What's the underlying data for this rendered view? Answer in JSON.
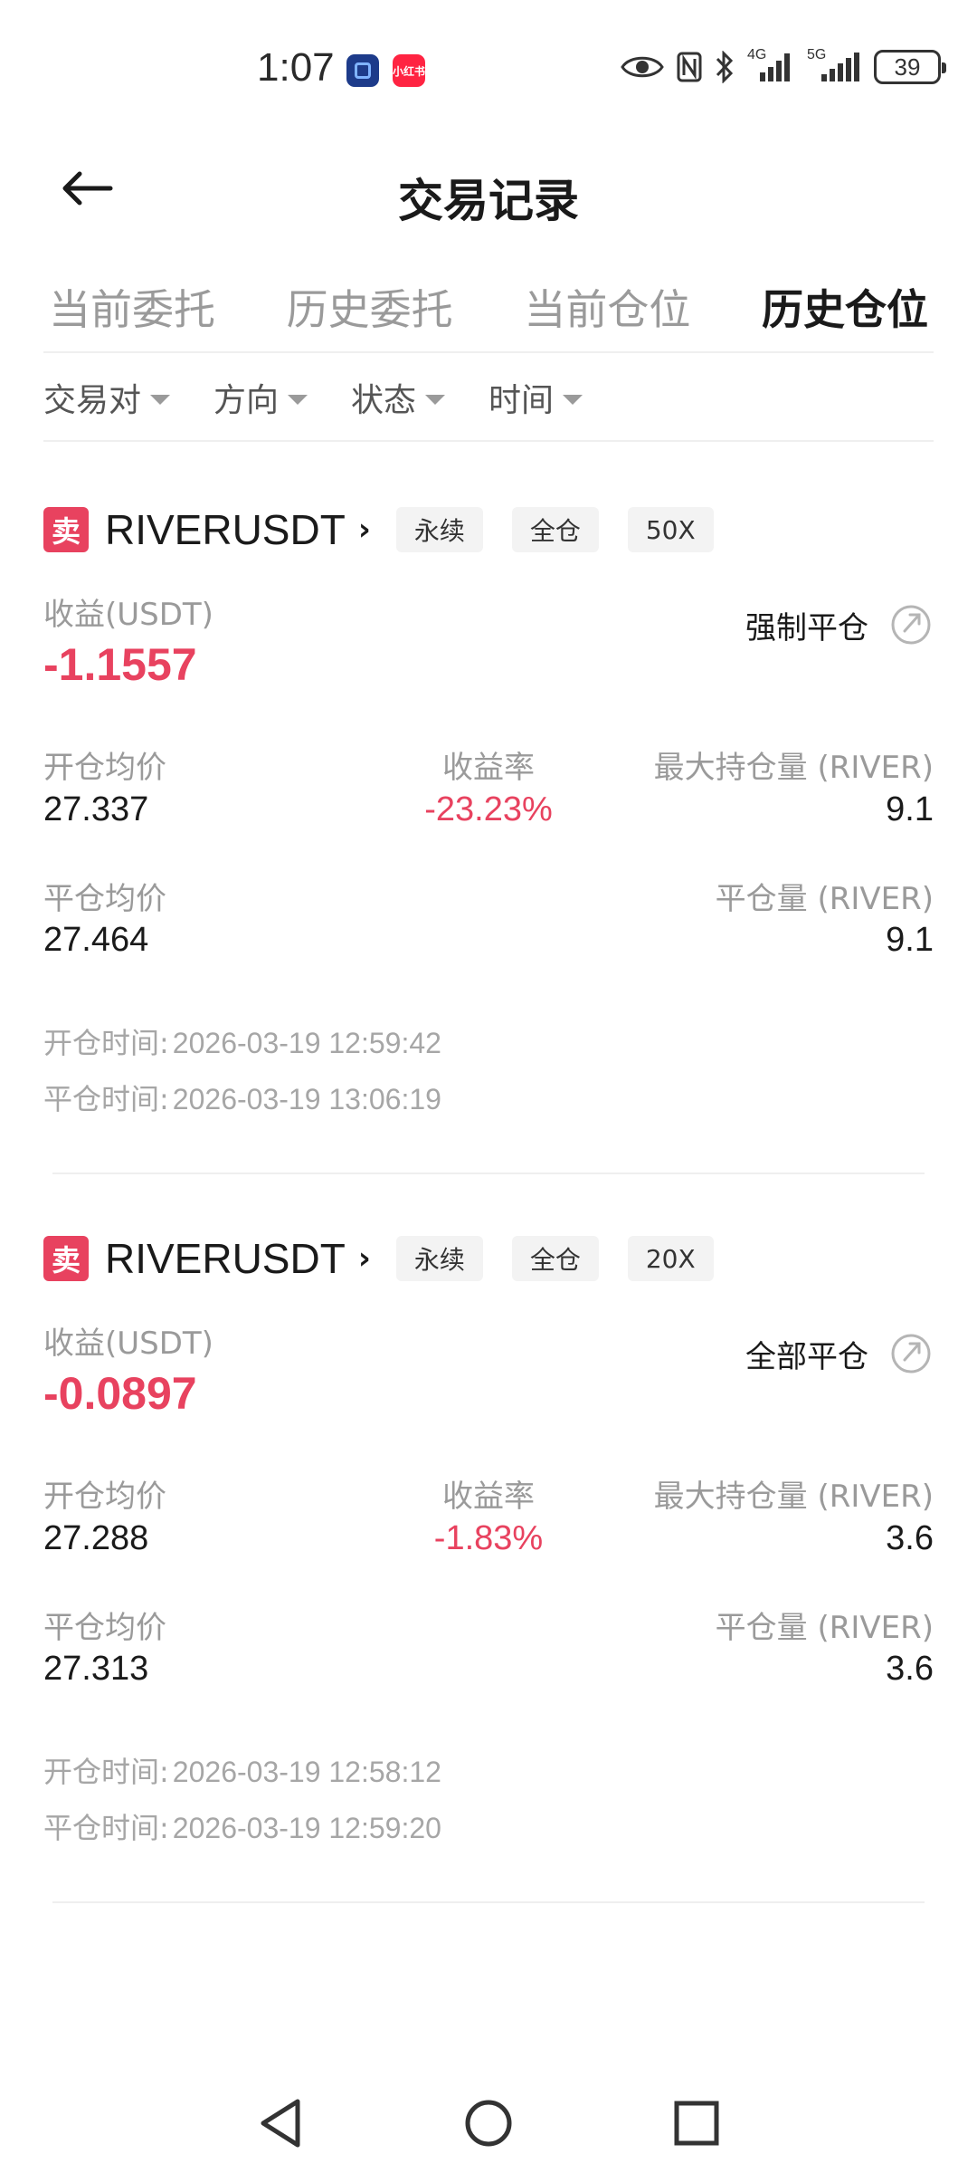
{
  "status_bar": {
    "time": "1:07",
    "app2_label": "小红书",
    "network1": "4G",
    "network2": "5G",
    "battery": "39"
  },
  "header": {
    "title": "交易记录"
  },
  "tabs": [
    {
      "label": "当前委托",
      "active": false
    },
    {
      "label": "历史委托",
      "active": false
    },
    {
      "label": "当前仓位",
      "active": false
    },
    {
      "label": "历史仓位",
      "active": true
    }
  ],
  "filters": [
    {
      "label": "交易对"
    },
    {
      "label": "方向"
    },
    {
      "label": "状态"
    },
    {
      "label": "时间"
    }
  ],
  "labels": {
    "pnl": "收益(USDT)",
    "open_avg": "开仓均价",
    "roe": "收益率",
    "max_pos": "最大持仓量 (RIVER)",
    "close_avg": "平仓均价",
    "close_qty": "平仓量 (RIVER)",
    "open_time": "开仓时间:",
    "close_time": "平仓时间:"
  },
  "positions": [
    {
      "side": "卖",
      "symbol": "RIVERUSDT",
      "tags": [
        "永续",
        "全仓",
        "50X"
      ],
      "close_type": "强制平仓",
      "pnl": "-1.1557",
      "open_avg": "27.337",
      "roe": "-23.23%",
      "max_pos": "9.1",
      "close_avg": "27.464",
      "close_qty": "9.1",
      "open_time": "2026-03-19 12:59:42",
      "close_time": "2026-03-19 13:06:19"
    },
    {
      "side": "卖",
      "symbol": "RIVERUSDT",
      "tags": [
        "永续",
        "全仓",
        "20X"
      ],
      "close_type": "全部平仓",
      "pnl": "-0.0897",
      "open_avg": "27.288",
      "roe": "-1.83%",
      "max_pos": "3.6",
      "close_avg": "27.313",
      "close_qty": "3.6",
      "open_time": "2026-03-19 12:58:12",
      "close_time": "2026-03-19 12:59:20"
    }
  ],
  "colors": {
    "accent_red": "#e8425f",
    "muted": "#9a9a9a",
    "text": "#1a1a1a"
  }
}
